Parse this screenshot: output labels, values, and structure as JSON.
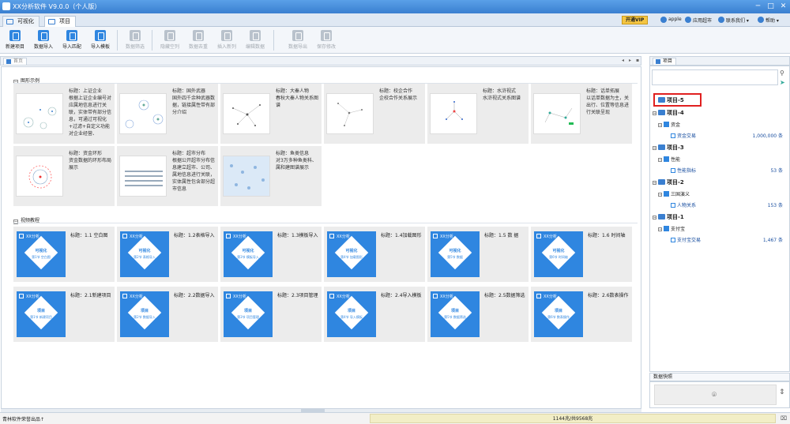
{
  "window": {
    "title": "XX分析软件 V9.0.0（个人版）",
    "controls": [
      "─",
      "□",
      "✕"
    ]
  },
  "top_tabs": [
    {
      "label": "可视化"
    },
    {
      "label": "项目"
    }
  ],
  "top_right": {
    "vip": "开通VIP",
    "user": "apple",
    "links": [
      "应用超市",
      "联系我们 ▾",
      "帮助 ▾"
    ]
  },
  "toolbar": {
    "items": [
      {
        "label": "新建项目",
        "icon": "new-project-icon",
        "enabled": true
      },
      {
        "label": "数据导入",
        "icon": "data-import-icon",
        "enabled": true
      },
      {
        "label": "导入匹配",
        "icon": "import-match-icon",
        "enabled": true
      },
      {
        "label": "导入模板",
        "icon": "import-template-icon",
        "enabled": true
      },
      {
        "label": "数据筛选",
        "icon": "filter-icon",
        "enabled": false
      },
      {
        "label": "隐藏空列",
        "icon": "hide-empty-icon",
        "enabled": false
      },
      {
        "label": "数据去重",
        "icon": "dedupe-icon",
        "enabled": false
      },
      {
        "label": "插入新列",
        "icon": "insert-column-icon",
        "enabled": false
      },
      {
        "label": "编辑数据",
        "icon": "edit-data-icon",
        "enabled": false
      },
      {
        "label": "数据导出",
        "icon": "export-icon",
        "enabled": false
      },
      {
        "label": "保存修改",
        "icon": "save-icon",
        "enabled": false
      }
    ]
  },
  "content_tab": {
    "label": "首页",
    "controls": [
      "◂",
      "▸",
      "▪"
    ]
  },
  "sections": {
    "graphs": "图形示例",
    "videos": "视频教程"
  },
  "graph_cards": [
    {
      "title": "标题：上证企业",
      "desc": "根据上证企业编号对应属地信息进行关联，实体带有部分信息，可通过可视化+过滤+自定义功能对企业经营、"
    },
    {
      "title": "标题：国外武器",
      "desc": "国外四千余种武器数据，链接属性带有部分介绍"
    },
    {
      "title": "标题：大秦人物",
      "desc": "春秋大秦人物关系图谱"
    },
    {
      "title": "标题：校企合作",
      "desc": "企校合作关系展示"
    },
    {
      "title": "标题：水浒视式",
      "desc": "水浒视式关系图谱"
    },
    {
      "title": "标题：话单拓展",
      "desc": "以话单数据为主，关出行、位置等信息进行关联呈现"
    },
    {
      "title": "标题：资金环形",
      "desc": "资金数据的环形布局展示"
    },
    {
      "title": "标题：超市分布",
      "desc": "根据公开超市分布信息建立超市、公司、属地信息进行关联，实体属性包含部分超市信息"
    },
    {
      "title": "标题：鱼类信息",
      "desc": "对3万多种鱼类科、属和建图谱展示"
    }
  ],
  "video_cards_row1": [
    {
      "title": "标题：1.1 空白图",
      "thumb_title": "可视化",
      "thumb_sub": "第1节 空白图"
    },
    {
      "title": "标题：1.2表格导入",
      "thumb_title": "可视化",
      "thumb_sub": "第2节 表格导入"
    },
    {
      "title": "标题：1.3模板导入",
      "thumb_title": "可视化",
      "thumb_sub": "第3节 模板导入"
    },
    {
      "title": "标题：1.4加载图形",
      "thumb_title": "可视化",
      "thumb_sub": "第4节 加载图形"
    },
    {
      "title": "标题：1.5 数 据",
      "thumb_title": "可视化",
      "thumb_sub": "第5节 数据"
    },
    {
      "title": "标题：1.6 时间轴",
      "thumb_title": "可视化",
      "thumb_sub": "第6节 时间轴"
    }
  ],
  "video_cards_row2": [
    {
      "title": "标题：2.1新建项目",
      "thumb_title": "项目",
      "thumb_sub": "第1节 新建项目"
    },
    {
      "title": "标题：2.2数据导入",
      "thumb_title": "项目",
      "thumb_sub": "第2节 数据导入"
    },
    {
      "title": "标题：2.3项目管理",
      "thumb_title": "项目",
      "thumb_sub": "第3节 项目管理"
    },
    {
      "title": "标题：2.4导入模板",
      "thumb_title": "项目",
      "thumb_sub": "第4节 导入模板"
    },
    {
      "title": "标题：2.5数据筛选",
      "thumb_title": "项目",
      "thumb_sub": "第5节 数据筛选"
    },
    {
      "title": "标题：2.6数表操作",
      "thumb_title": "项目",
      "thumb_sub": "第6节 数表操作"
    }
  ],
  "video_logo_text": "XX分析",
  "project_panel": {
    "tab": "项目",
    "tree": [
      {
        "project": "项目-5",
        "children": []
      },
      {
        "project": "项目-4",
        "children": [
          {
            "folder": "资金",
            "tables": [
              {
                "name": "资金交易",
                "count": "1,000,000 条"
              }
            ]
          }
        ]
      },
      {
        "project": "项目-3",
        "children": [
          {
            "folder": "性能",
            "tables": [
              {
                "name": "性能指标",
                "count": "53 条"
              }
            ]
          }
        ]
      },
      {
        "project": "项目-2",
        "children": [
          {
            "folder": "三国演义",
            "tables": [
              {
                "name": "人物关系",
                "count": "153 条"
              }
            ]
          }
        ]
      },
      {
        "project": "项目-1",
        "children": [
          {
            "folder": "支付宝",
            "tables": [
              {
                "name": "支付宝交易",
                "count": "1,467 条"
              }
            ]
          }
        ]
      }
    ]
  },
  "data_panel": {
    "label": "数据快照"
  },
  "status": {
    "left": "青林软件荣誉出品↑",
    "memory": "1144兆/共9568兆"
  }
}
